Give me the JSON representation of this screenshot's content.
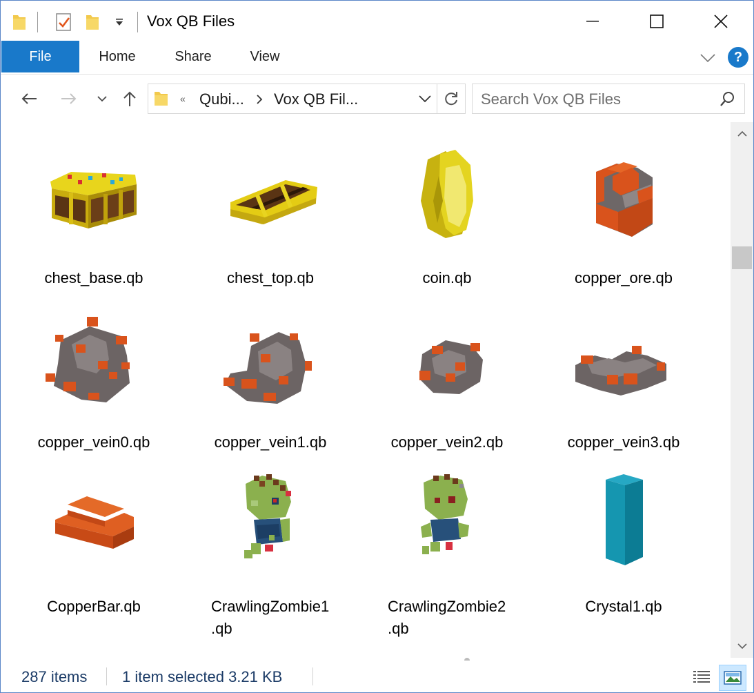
{
  "window": {
    "title": "Vox QB Files",
    "controls": {
      "minimize": "minimize-icon",
      "maximize": "maximize-icon",
      "close": "close-icon"
    }
  },
  "quick_access": [
    "folder-icon",
    "properties-check-icon",
    "new-folder-icon",
    "customize-dropdown-icon"
  ],
  "ribbon": {
    "tabs": [
      {
        "label": "File",
        "active": true
      },
      {
        "label": "Home"
      },
      {
        "label": "Share"
      },
      {
        "label": "View"
      }
    ]
  },
  "address": {
    "overflow": "«",
    "segments": [
      "Qubi...",
      "Vox QB Fil..."
    ]
  },
  "search": {
    "placeholder": "Search Vox QB Files"
  },
  "files": [
    {
      "name": "chest_base.qb",
      "thumb": "chest-base-thumbnail"
    },
    {
      "name": "chest_top.qb",
      "thumb": "chest-top-thumbnail"
    },
    {
      "name": "coin.qb",
      "thumb": "coin-thumbnail"
    },
    {
      "name": "copper_ore.qb",
      "thumb": "copper-ore-thumbnail"
    },
    {
      "name": "copper_vein0.qb",
      "thumb": "copper-vein0-thumbnail"
    },
    {
      "name": "copper_vein1.qb",
      "thumb": "copper-vein1-thumbnail"
    },
    {
      "name": "copper_vein2.qb",
      "thumb": "copper-vein2-thumbnail"
    },
    {
      "name": "copper_vein3.qb",
      "thumb": "copper-vein3-thumbnail"
    },
    {
      "name": "CopperBar.qb",
      "thumb": "copper-bar-thumbnail"
    },
    {
      "name": "CrawlingZombie1\n.qb",
      "thumb": "crawling-zombie1-thumbnail"
    },
    {
      "name": "CrawlingZombie2\n.qb",
      "thumb": "crawling-zombie2-thumbnail"
    },
    {
      "name": "Crystal1.qb",
      "thumb": "crystal1-thumbnail"
    }
  ],
  "status": {
    "items_count": "287 items",
    "selection": "1 item selected  3.21 KB"
  },
  "colors": {
    "file_tab": "#1979ca",
    "help": "#1979ca",
    "status_text": "#1a3a66",
    "copper": "#d9531c",
    "stone": "#716a6a",
    "gold": "#e4c812",
    "zombie_skin": "#8bb04e",
    "crystal": "#1596b0"
  }
}
